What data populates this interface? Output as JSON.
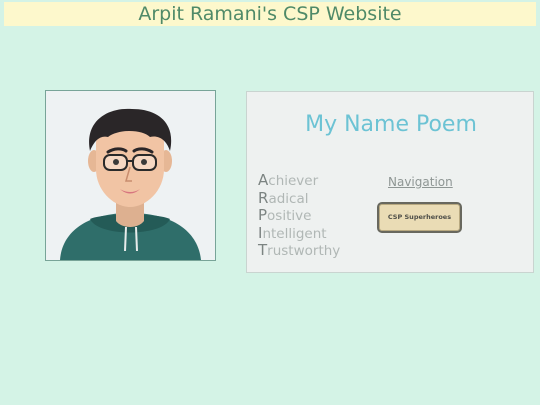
{
  "header": {
    "title": "Arpit Ramani's CSP Website"
  },
  "avatar": {
    "icon": "cartoon-avatar-portrait"
  },
  "poem": {
    "title": "My Name Poem",
    "lines": [
      {
        "initial": "A",
        "rest": "chiever"
      },
      {
        "initial": "R",
        "rest": "adical"
      },
      {
        "initial": "P",
        "rest": "ositive"
      },
      {
        "initial": "I",
        "rest": "ntelligent"
      },
      {
        "initial": "T",
        "rest": "rustworthy"
      }
    ]
  },
  "navigation": {
    "label": "Navigation",
    "button_label": "CSP Superheroes"
  },
  "colors": {
    "background": "#d4f3e6",
    "title_bar": "#fdf8cc",
    "title_text": "#4f8a68",
    "poem_title": "#6cc3d4",
    "button_fill": "#eadcb5"
  }
}
